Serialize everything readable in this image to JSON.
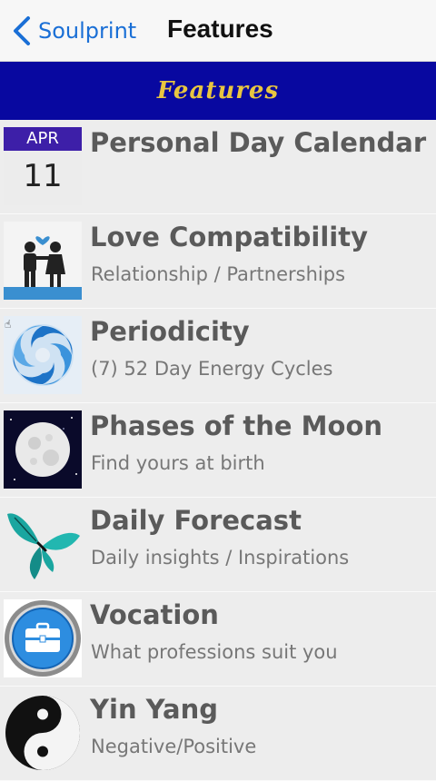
{
  "nav": {
    "back_label": "Soulprint",
    "title": "Features"
  },
  "banner": {
    "text": "Features"
  },
  "calendar": {
    "month": "APR",
    "day": "11"
  },
  "items": [
    {
      "title": "Personal Day Calendar",
      "subtitle": "",
      "icon": "calendar-icon"
    },
    {
      "title": "Love Compatibility",
      "subtitle": "Relationship / Partnerships",
      "icon": "couple-icon"
    },
    {
      "title": "Periodicity",
      "subtitle": "(7) 52 Day Energy Cycles",
      "icon": "cycle-swirl-icon"
    },
    {
      "title": "Phases of the Moon",
      "subtitle": "Find yours at birth",
      "icon": "moon-icon"
    },
    {
      "title": "Daily Forecast",
      "subtitle": "Daily insights / Inspirations",
      "icon": "butterfly-icon"
    },
    {
      "title": "Vocation",
      "subtitle": "What professions suit you",
      "icon": "briefcase-icon"
    },
    {
      "title": "Yin Yang",
      "subtitle": "Negative/Positive",
      "icon": "yin-yang-icon"
    }
  ],
  "colors": {
    "banner_bg": "#0808a0",
    "banner_text": "#e8c640",
    "link": "#1a6fd6",
    "title_text": "#5a5a5a"
  }
}
